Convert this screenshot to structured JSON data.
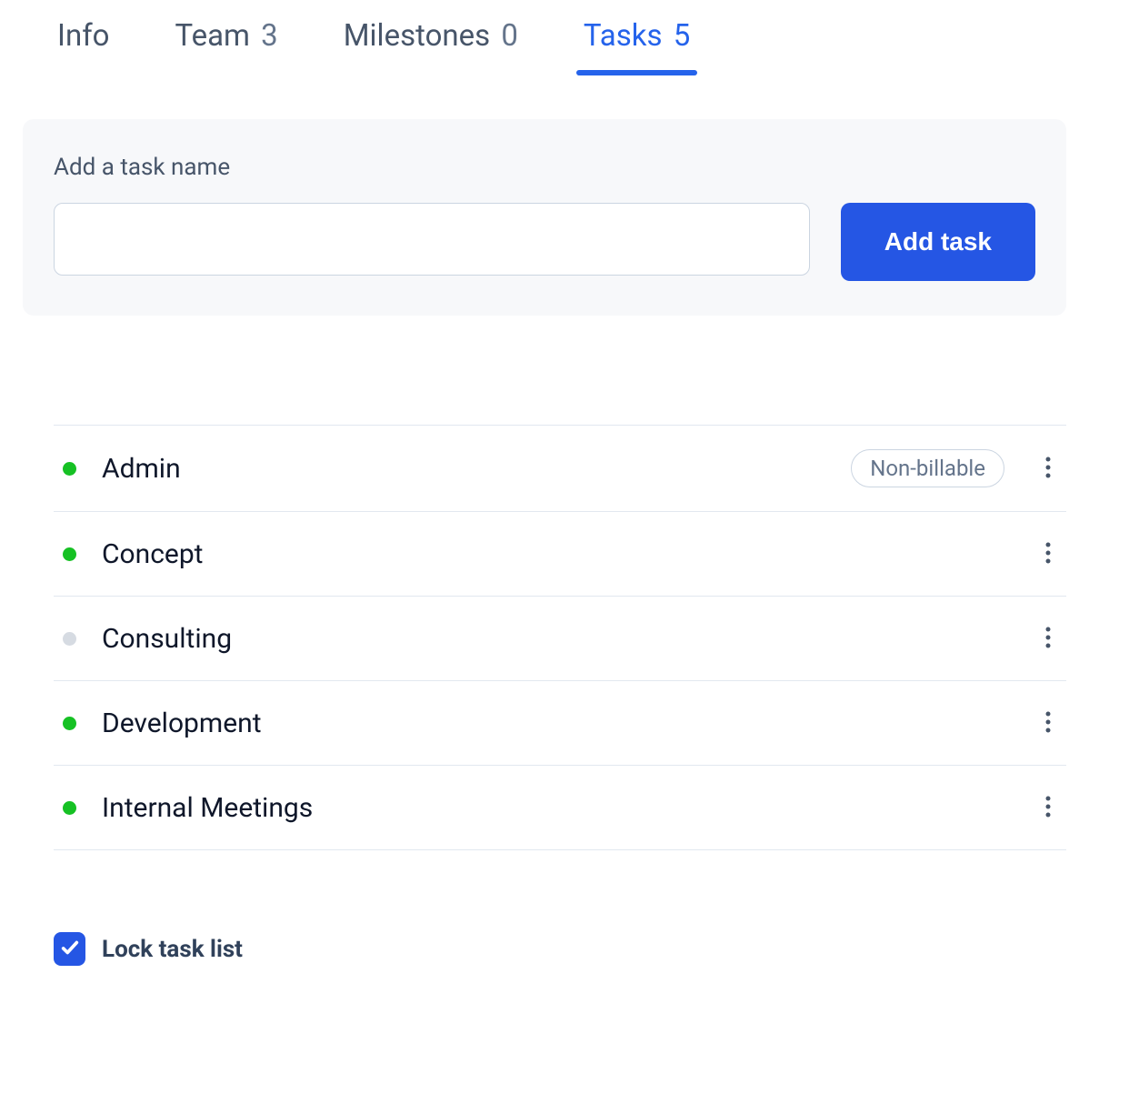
{
  "tabs": [
    {
      "label": "Info",
      "count": null,
      "active": false
    },
    {
      "label": "Team",
      "count": "3",
      "active": false
    },
    {
      "label": "Milestones",
      "count": "0",
      "active": false
    },
    {
      "label": "Tasks",
      "count": "5",
      "active": true
    }
  ],
  "add_panel": {
    "label": "Add a task name",
    "input_value": "",
    "button_label": "Add task"
  },
  "tasks": [
    {
      "name": "Admin",
      "status": "green",
      "badge": "Non-billable"
    },
    {
      "name": "Concept",
      "status": "green",
      "badge": null
    },
    {
      "name": "Consulting",
      "status": "grey",
      "badge": null
    },
    {
      "name": "Development",
      "status": "green",
      "badge": null
    },
    {
      "name": "Internal Meetings",
      "status": "green",
      "badge": null
    }
  ],
  "lock": {
    "label": "Lock task list",
    "checked": true
  }
}
